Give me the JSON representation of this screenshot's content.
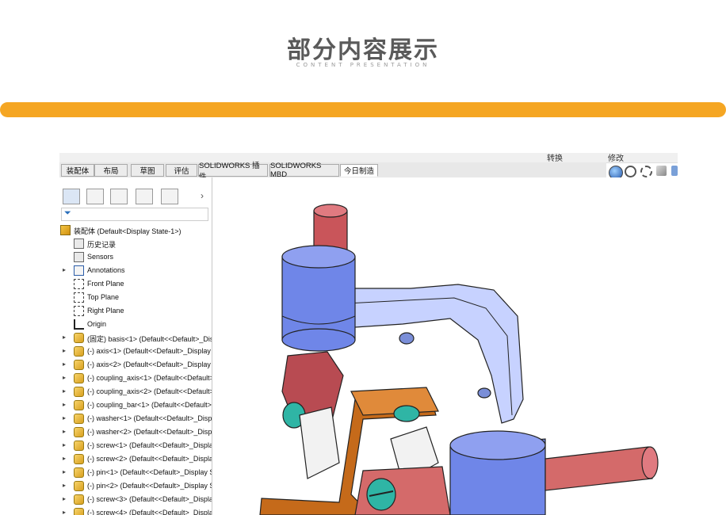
{
  "header": {
    "title": "部分内容展示",
    "subtitle": "CONTENT PRESENTATION"
  },
  "colors": {
    "accent_bar": "#f5a623",
    "part_blue": "#6f86e8",
    "part_red": "#d46a6a",
    "part_orange": "#c56a1a",
    "part_teal": "#2fb5a5"
  },
  "toolbar": {
    "top_labels": [
      "转换",
      "修改"
    ]
  },
  "tabs": [
    {
      "label": "装配体"
    },
    {
      "label": "布局"
    },
    {
      "label": "草图"
    },
    {
      "label": "评估"
    },
    {
      "label": "SOLIDWORKS 插件"
    },
    {
      "label": "SOLIDWORKS MBD"
    },
    {
      "label": "今日制造"
    }
  ],
  "tree": {
    "root": "装配体  (Default<Display State-1>)",
    "items": [
      {
        "label": "历史记录",
        "icon": "history-icon",
        "expand": false
      },
      {
        "label": "Sensors",
        "icon": "sensor-icon",
        "expand": false
      },
      {
        "label": "Annotations",
        "icon": "annotation-icon",
        "expand": true
      },
      {
        "label": "Front Plane",
        "icon": "plane-icon",
        "expand": false
      },
      {
        "label": "Top Plane",
        "icon": "plane-icon",
        "expand": false
      },
      {
        "label": "Right Plane",
        "icon": "plane-icon",
        "expand": false
      },
      {
        "label": "Origin",
        "icon": "origin-icon",
        "expand": false
      },
      {
        "label": "(固定) basis<1> (Default<<Default>_Dis",
        "icon": "part-icon",
        "expand": true
      },
      {
        "label": "(-) axis<1> (Default<<Default>_Display",
        "icon": "part-icon",
        "expand": true
      },
      {
        "label": "(-) axis<2> (Default<<Default>_Display",
        "icon": "part-icon",
        "expand": true
      },
      {
        "label": "(-) coupling_axis<1> (Default<<Default>",
        "icon": "part-icon",
        "expand": true
      },
      {
        "label": "(-) coupling_axis<2> (Default<<Default>",
        "icon": "part-icon",
        "expand": true
      },
      {
        "label": "(-) coupling_bar<1> (Default<<Default>",
        "icon": "part-icon",
        "expand": true
      },
      {
        "label": "(-) washer<1> (Default<<Default>_Disp",
        "icon": "part-icon",
        "expand": true
      },
      {
        "label": "(-) washer<2> (Default<<Default>_Disp",
        "icon": "part-icon",
        "expand": true
      },
      {
        "label": "(-) screw<1> (Default<<Default>_Displa",
        "icon": "part-icon",
        "expand": true
      },
      {
        "label": "(-) screw<2> (Default<<Default>_Displa",
        "icon": "part-icon",
        "expand": true
      },
      {
        "label": "(-) pin<1> (Default<<Default>_Display S",
        "icon": "part-icon",
        "expand": true
      },
      {
        "label": "(-) pin<2> (Default<<Default>_Display S",
        "icon": "part-icon",
        "expand": true
      },
      {
        "label": "(-) screw<3> (Default<<Default>_Displa",
        "icon": "part-icon",
        "expand": true
      },
      {
        "label": "(-) screw<4> (Default<<Default>_Displa",
        "icon": "part-icon",
        "expand": true
      }
    ]
  }
}
